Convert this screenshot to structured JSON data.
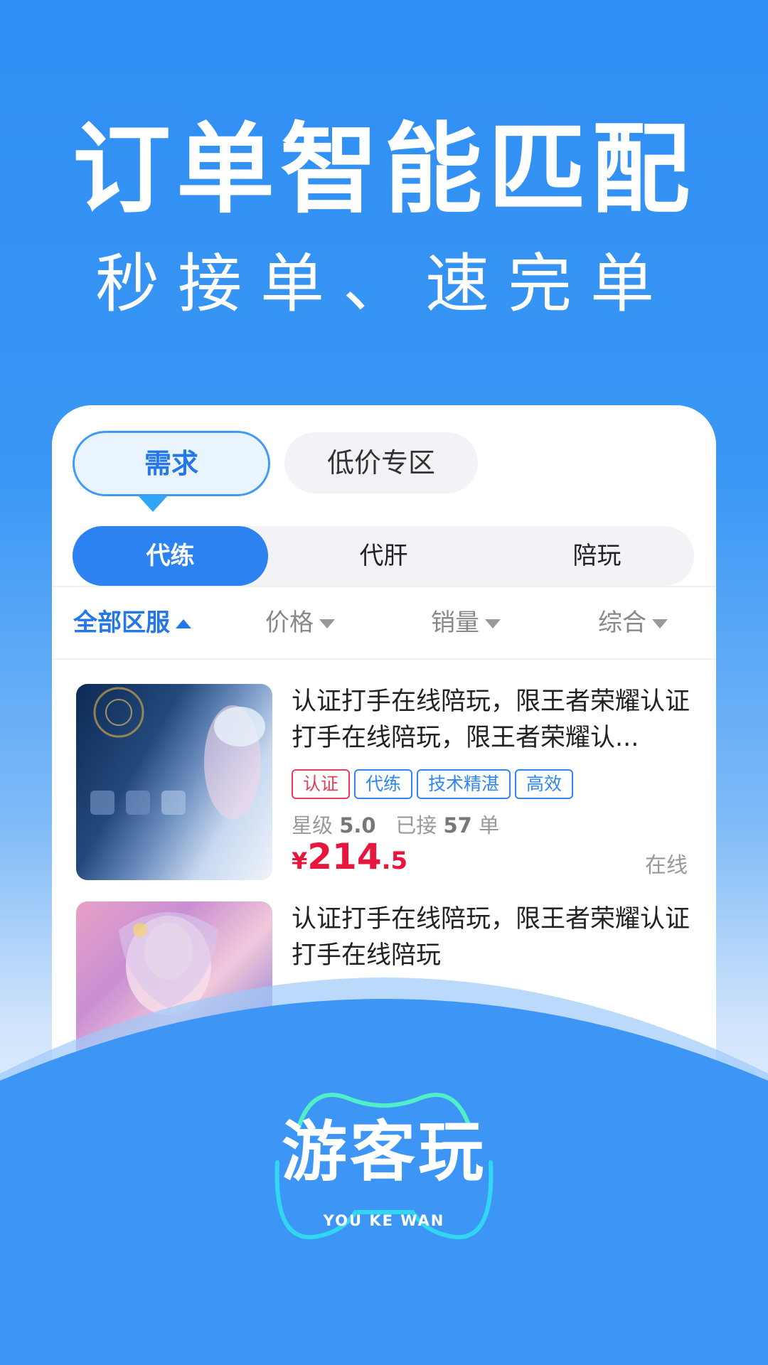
{
  "hero": {
    "title": "订单智能匹配",
    "subtitle": "秒接单、速完单"
  },
  "top_tabs": [
    {
      "label": "需求",
      "active": true
    },
    {
      "label": "低价专区",
      "active": false
    }
  ],
  "segments": [
    {
      "label": "代练",
      "active": true
    },
    {
      "label": "代肝",
      "active": false
    },
    {
      "label": "陪玩",
      "active": false
    }
  ],
  "filters": [
    {
      "label": "全部区服",
      "active": true
    },
    {
      "label": "价格",
      "active": false
    },
    {
      "label": "销量",
      "active": false
    },
    {
      "label": "综合",
      "active": false
    }
  ],
  "listings": [
    {
      "title": "认证打手在线陪玩，限王者荣耀认证打手在线陪玩，限王者荣耀认...",
      "tags": [
        "认证",
        "代练",
        "技术精湛",
        "高效"
      ],
      "star_label": "星级",
      "star_value": "5.0",
      "taken_label": "已接",
      "taken_value": "57",
      "taken_unit": "单",
      "price_currency": "¥",
      "price_int": "214",
      "price_dec": ".5",
      "status": "在线"
    },
    {
      "title": "认证打手在线陪玩，限王者荣耀认证打手在线陪玩"
    }
  ],
  "logo": {
    "name": "游客玩",
    "name_en": "YOU KE WAN"
  },
  "colors": {
    "primary": "#2b82f0",
    "price": "#e8153d",
    "tag_red": "#e43d5a",
    "accent_cyan": "#2ee6e0"
  }
}
